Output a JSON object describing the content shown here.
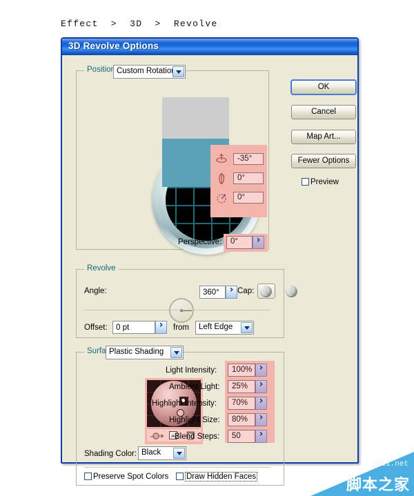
{
  "breadcrumb": "Effect  >  3D  >  Revolve",
  "dialog": {
    "title": "3D Revolve Options"
  },
  "position": {
    "label": "Position:",
    "preset": "Custom Rotation",
    "rotations": [
      {
        "axis_icon": "rotate-x-icon",
        "value": "-35°"
      },
      {
        "axis_icon": "rotate-y-icon",
        "value": "0°"
      },
      {
        "axis_icon": "rotate-z-icon",
        "value": "0°"
      }
    ],
    "perspective_label": "Perspective:",
    "perspective_value": "0°"
  },
  "revolve": {
    "group_label": "Revolve",
    "angle_label": "Angle:",
    "angle_value": "360°",
    "cap_label": "Cap:",
    "offset_label": "Offset:",
    "offset_value": "0 pt",
    "from_label": "from",
    "from_value": "Left Edge"
  },
  "surface": {
    "label": "Surface:",
    "shading": "Plastic Shading",
    "params": [
      {
        "label": "Light Intensity:",
        "value": "100%"
      },
      {
        "label": "Ambient Light:",
        "value": "25%"
      },
      {
        "label": "Highlight Intensity:",
        "value": "70%"
      },
      {
        "label": "Highlight Size:",
        "value": "80%"
      },
      {
        "label": "Blend Steps:",
        "value": "50"
      }
    ],
    "shading_color_label": "Shading Color:",
    "shading_color_value": "Black",
    "preserve_spot_colors": "Preserve Spot Colors",
    "draw_hidden_faces": "Draw Hidden Faces"
  },
  "buttons": {
    "ok": "OK",
    "cancel": "Cancel",
    "map_art": "Map Art...",
    "fewer_options": "Fewer Options",
    "preview": "Preview"
  },
  "watermark": {
    "domain": "jb51.net",
    "text": "脚本之家"
  },
  "colors": {
    "titlebar_blue": "#0d58d0",
    "dialog_face": "#ece9d8",
    "group_label_teal": "#176b74",
    "highlight_pink": "#f3b5ab",
    "field_pink": "#fbd3d1",
    "track_teal": "#5ba2b8"
  }
}
